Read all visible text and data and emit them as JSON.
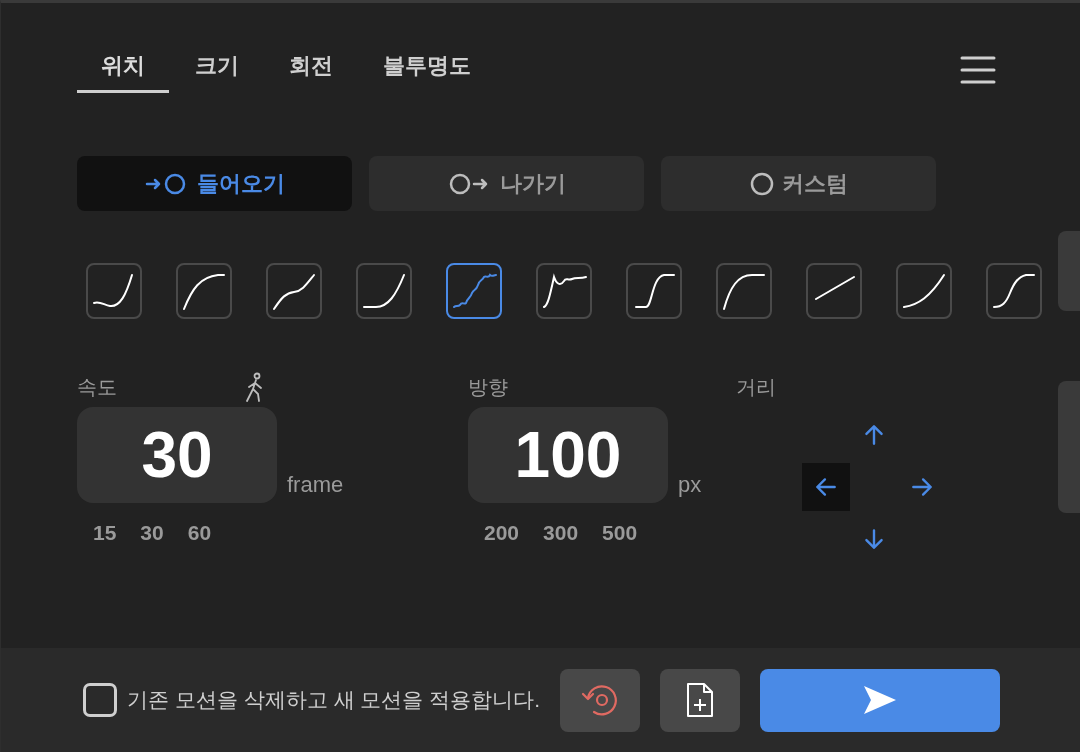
{
  "tabs": [
    {
      "label": "위치",
      "selected": true
    },
    {
      "label": "크기",
      "selected": false
    },
    {
      "label": "회전",
      "selected": false
    },
    {
      "label": "불투명도",
      "selected": false
    }
  ],
  "modes": [
    {
      "label": "들어오기",
      "kind": "in",
      "selected": true
    },
    {
      "label": "나가기",
      "kind": "out",
      "selected": false
    },
    {
      "label": "커스텀",
      "kind": "custom",
      "selected": false
    }
  ],
  "curves": [
    {
      "selected": false
    },
    {
      "selected": false
    },
    {
      "selected": false
    },
    {
      "selected": false
    },
    {
      "selected": true
    },
    {
      "selected": false
    },
    {
      "selected": false
    },
    {
      "selected": false
    },
    {
      "selected": false
    },
    {
      "selected": false
    },
    {
      "selected": false
    }
  ],
  "speed": {
    "label": "속도",
    "value": "30",
    "unit": "frame",
    "presets": [
      "15",
      "30",
      "60"
    ]
  },
  "direction": {
    "label": "방향",
    "value": "100",
    "unit": "px",
    "presets": [
      "200",
      "300",
      "500"
    ]
  },
  "distance": {
    "label": "거리",
    "arrows": [
      {
        "kind": "up",
        "selected": false
      },
      {
        "kind": "left",
        "selected": true
      },
      {
        "kind": "right",
        "selected": false
      },
      {
        "kind": "down",
        "selected": false
      }
    ]
  },
  "footer": {
    "checkbox": {
      "label": "기존 모션을 삭제하고 새 모션을 적용합니다.",
      "checked": false
    }
  }
}
